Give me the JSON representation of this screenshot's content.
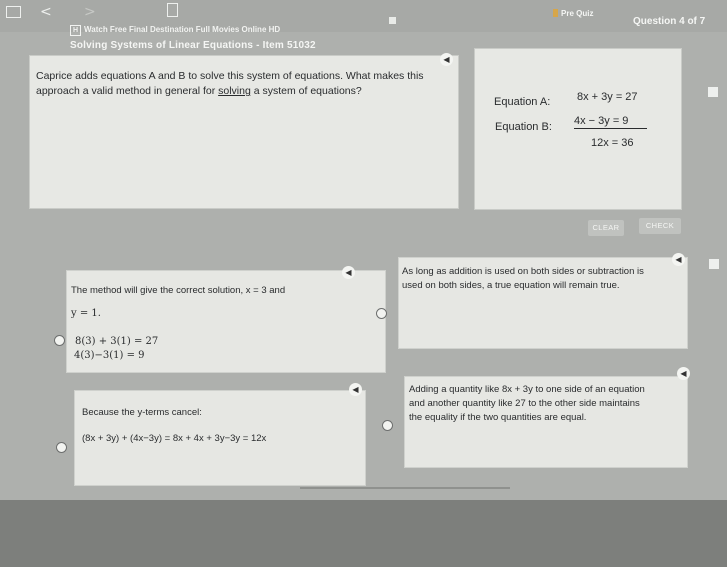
{
  "header": {
    "tab_title": "Watch Free Final Destination Full Movies Online HD",
    "tab_badge": "H",
    "subtitle": "Solving Systems of Linear Equations - Item 51032",
    "prequiz": "Pre Quiz",
    "question_counter": "Question 4 of 7"
  },
  "question": {
    "text_before": "Caprice adds equations A and B to solve this system of equations. What makes this approach a valid method in general for ",
    "link": "solving",
    "text_after": " a system of equations?",
    "equation_a_label": "Equation A:",
    "equation_a": "8x + 3y = 27",
    "equation_b_label": "Equation B:",
    "equation_b": "4x − 3y =  9",
    "sum": "12x = 36"
  },
  "buttons": {
    "clear": "CLEAR",
    "check": "CHECK"
  },
  "options": [
    {
      "line1": "The method will give the correct solution, x = 3 and",
      "line2": "y = 1.",
      "line3": "8(3) + 3(1) = 27",
      "line4": "4(3)−3(1) = 9"
    },
    {
      "line1": "As long as addition is used on both sides or subtraction is",
      "line2": "used on both sides, a true equation will remain true."
    },
    {
      "line1": "Because the y-terms cancel:",
      "line2": "(8x + 3y) + (4x−3y) = 8x + 4x + 3y−3y = 12x"
    },
    {
      "line1": "Adding a quantity like 8x + 3y to one side of an equation",
      "line2": "and another quantity like 27 to the other side maintains",
      "line3": "the equality if the two quantities are equal."
    }
  ],
  "icons": {
    "speaker": "◀",
    "window": "□",
    "back": "<",
    "forward": ">"
  }
}
